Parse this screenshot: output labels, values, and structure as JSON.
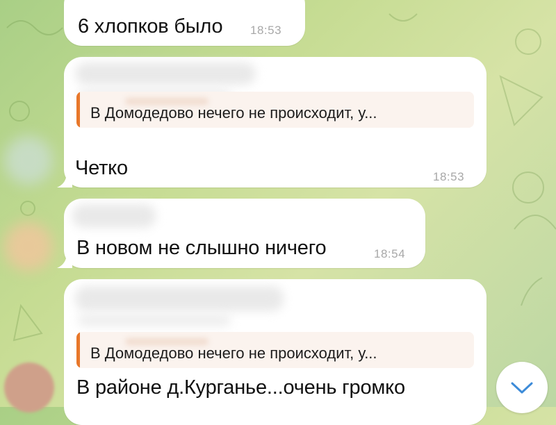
{
  "colors": {
    "background": "#b9d58f",
    "bubble": "#ffffff",
    "reply_accent": "#e8772a",
    "reply_background": "#fbf3ee",
    "timestamp": "#a8a8a8",
    "scroll_arrow": "#3d8bd8"
  },
  "messages": [
    {
      "text": "6 хлопков было",
      "time": "18:53"
    },
    {
      "reply_preview": "В Домодедово нечего не происходит, у...",
      "text": "Четко",
      "time": "18:53"
    },
    {
      "text": "В новом не слышно ничего",
      "time": "18:54"
    },
    {
      "reply_preview": "В Домодедово нечего не происходит, у...",
      "text": "В районе д.Курганье...очень громко"
    }
  ],
  "scroll_button": {
    "icon": "chevron-down-icon"
  }
}
